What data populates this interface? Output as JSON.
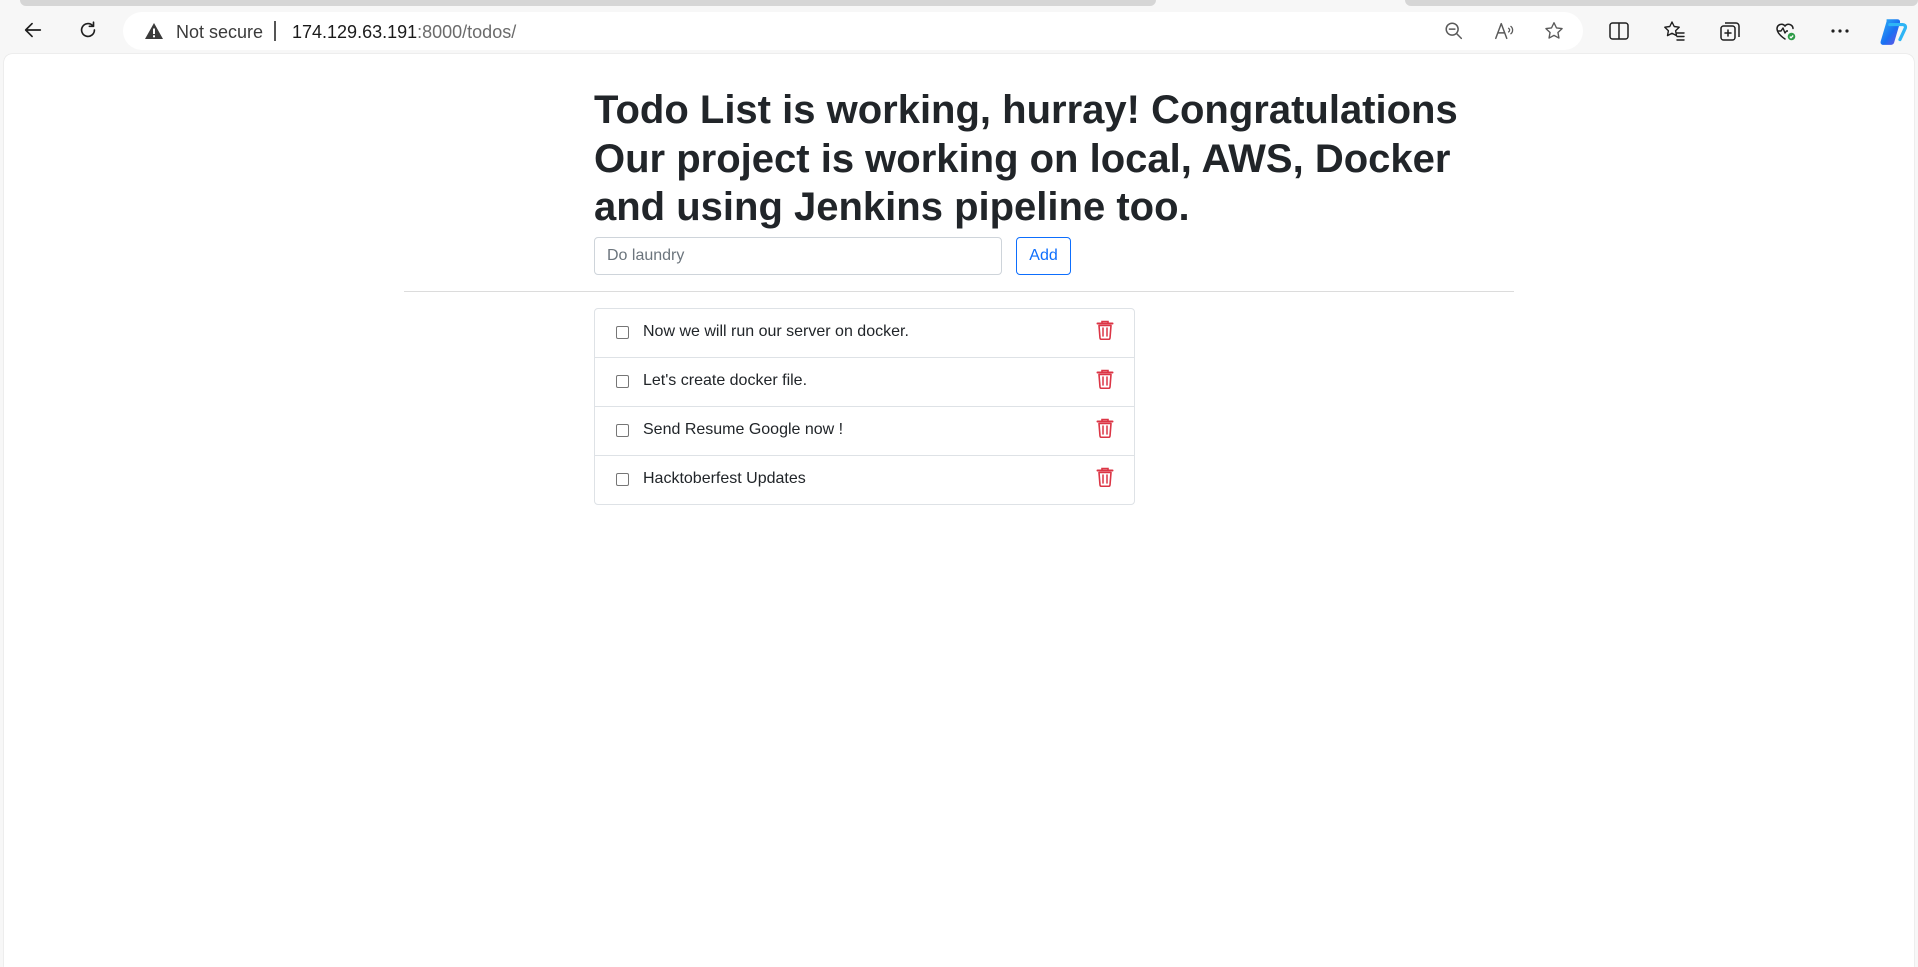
{
  "browser": {
    "security_label": "Not secure",
    "url_host": "174.129.63.191",
    "url_rest": ":8000/todos/"
  },
  "page": {
    "heading": "Todo List is working, hurray! Congratulations Our project is working on local, AWS, Docker and using Jenkins pipeline too.",
    "input_placeholder": "Do laundry",
    "add_label": "Add",
    "todos": [
      {
        "text": "Now we will run our server on docker.",
        "done": false
      },
      {
        "text": "Let's create docker file.",
        "done": false
      },
      {
        "text": "Send Resume Google now !",
        "done": false
      },
      {
        "text": "Hacktoberfest Updates",
        "done": false
      }
    ]
  },
  "colors": {
    "accent": "#0d6efd",
    "delete": "#dc3545",
    "text": "#212529"
  },
  "icons": {
    "back": "back-arrow-icon",
    "refresh": "refresh-icon",
    "warning": "warning-icon",
    "zoom": "zoom-out-icon",
    "read_aloud": "read-aloud-icon",
    "favorite": "star-icon",
    "split": "split-screen-icon",
    "favorites": "favorites-icon",
    "collections": "collections-icon",
    "health": "browser-essentials-icon",
    "more": "more-icon",
    "copilot": "copilot-icon",
    "delete": "trash-icon"
  }
}
